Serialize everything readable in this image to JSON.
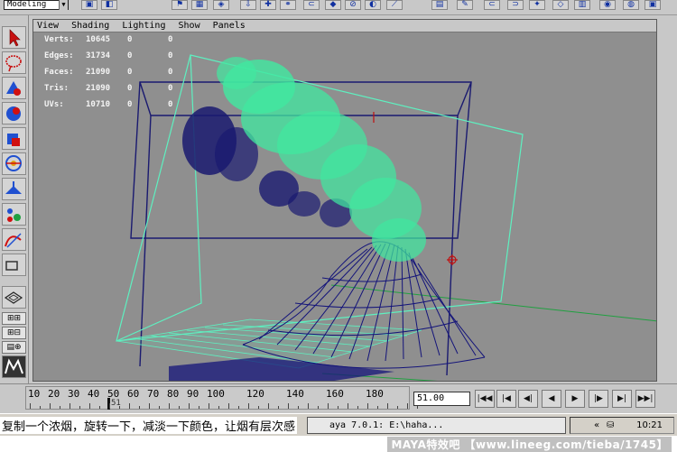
{
  "shelf": {
    "mode": "Modeling"
  },
  "panel_menu": [
    "View",
    "Shading",
    "Lighting",
    "Show",
    "Panels"
  ],
  "hud": [
    {
      "label": "Verts:",
      "total": "10645",
      "sel": "0",
      "comp": "0"
    },
    {
      "label": "Edges:",
      "total": "31734",
      "sel": "0",
      "comp": "0"
    },
    {
      "label": "Faces:",
      "total": "21090",
      "sel": "0",
      "comp": "0"
    },
    {
      "label": "Tris:",
      "total": "21090",
      "sel": "0",
      "comp": "0"
    },
    {
      "label": "UVs:",
      "total": "10710",
      "sel": "0",
      "comp": "0"
    }
  ],
  "timeline": {
    "ticks": [
      "10",
      "20",
      "30",
      "40",
      "50",
      "60",
      "70",
      "80",
      "90",
      "100",
      "120",
      "140",
      "160",
      "180"
    ],
    "current_frame_label": "51",
    "current_frame": "51.00"
  },
  "taskbar": {
    "item": "aya 7.0.1: E:\\haha...",
    "clock": "10:21",
    "tray_arrows": "«"
  },
  "caption": "复制一个浓烟，旋转一下，减淡一下颜色，让烟有层次感",
  "watermark": "MAYA特效吧 【www.lineeg.com/tieba/1745】",
  "colors": {
    "viewport_bg": "#8f8f8f",
    "wireframe": "#14147a",
    "smoke_green": "#40e8a0",
    "smoke_dark": "#1a1a70",
    "bounding_green": "#5ef0c0"
  }
}
